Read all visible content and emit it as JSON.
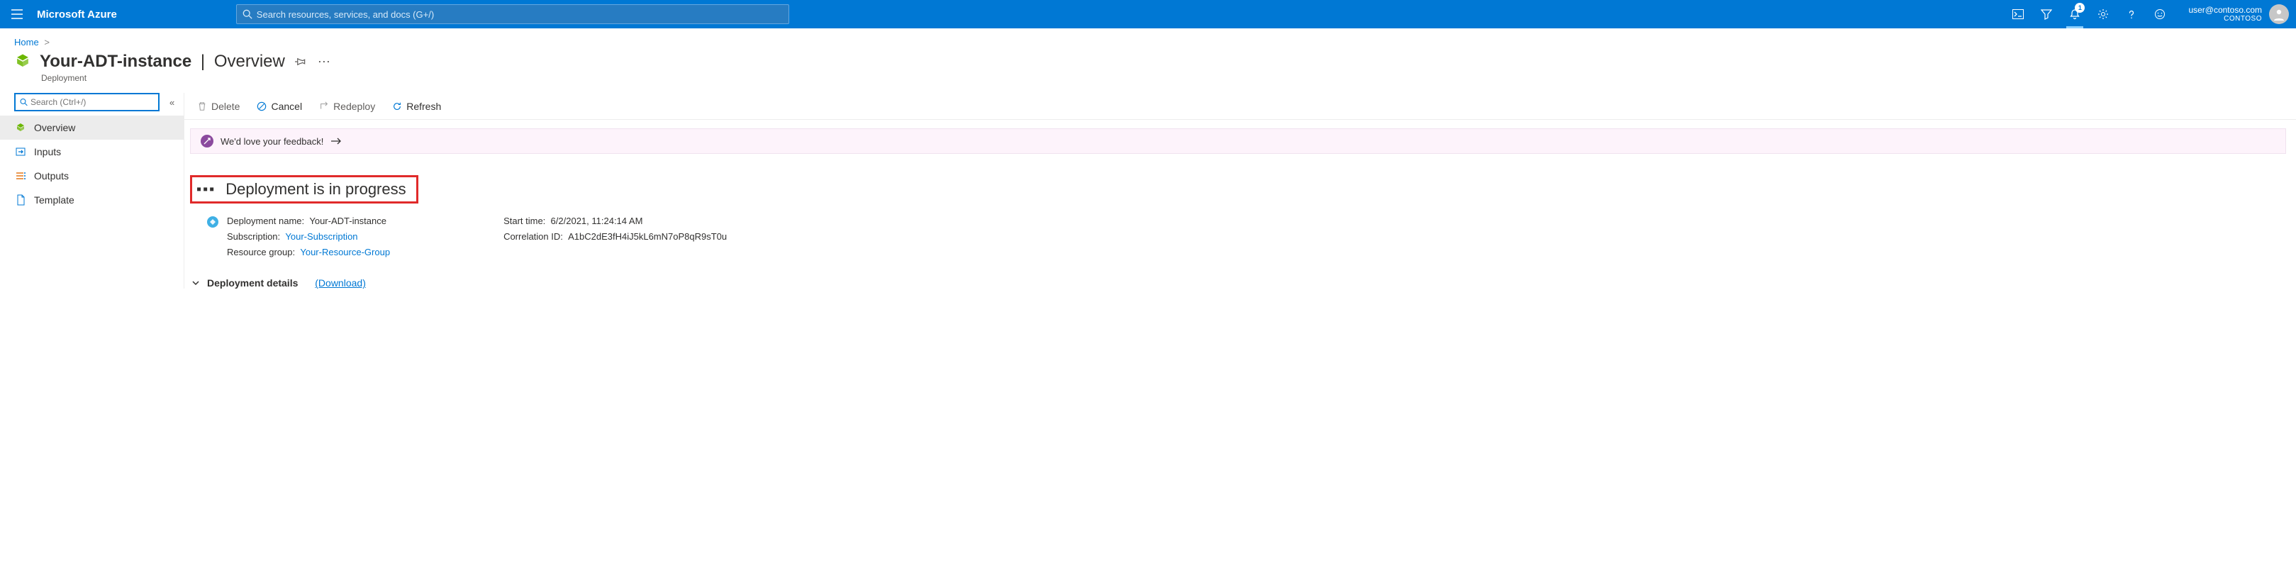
{
  "header": {
    "brand": "Microsoft Azure",
    "search_placeholder": "Search resources, services, and docs (G+/)",
    "notification_count": "1",
    "user_email": "user@contoso.com",
    "tenant": "CONTOSO"
  },
  "breadcrumb": {
    "home": "Home"
  },
  "title": {
    "resource_name": "Your-ADT-instance",
    "section": "Overview",
    "subtitle": "Deployment"
  },
  "sidebar": {
    "search_placeholder": "Search (Ctrl+/)",
    "items": [
      {
        "label": "Overview"
      },
      {
        "label": "Inputs"
      },
      {
        "label": "Outputs"
      },
      {
        "label": "Template"
      }
    ]
  },
  "toolbar": {
    "delete": "Delete",
    "cancel": "Cancel",
    "redeploy": "Redeploy",
    "refresh": "Refresh"
  },
  "feedback": {
    "text": "We'd love your feedback!"
  },
  "status": {
    "title": "Deployment is in progress"
  },
  "deployment": {
    "left": {
      "name_label": "Deployment name:",
      "name_value": "Your-ADT-instance",
      "sub_label": "Subscription:",
      "sub_value": "Your-Subscription",
      "rg_label": "Resource group:",
      "rg_value": "Your-Resource-Group"
    },
    "right": {
      "start_label": "Start time:",
      "start_value": "6/2/2021, 11:24:14 AM",
      "corr_label": "Correlation ID:",
      "corr_value": "A1bC2dE3fH4iJ5kL6mN7oP8qR9sT0u"
    }
  },
  "deployment_details": {
    "label": "Deployment details",
    "download": "(Download)"
  }
}
